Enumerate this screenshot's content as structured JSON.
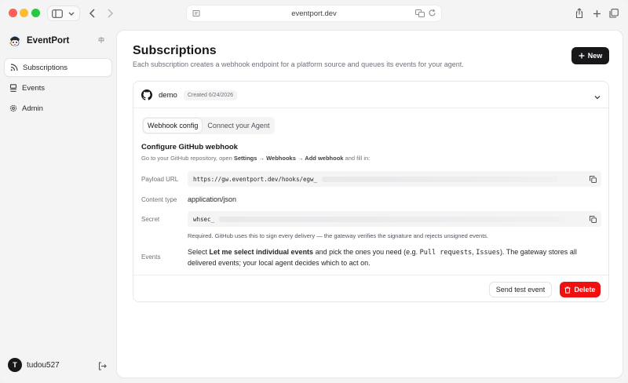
{
  "browser": {
    "url": "eventport.dev"
  },
  "sidebar": {
    "brand": "EventPort",
    "lang_label": "中",
    "items": [
      {
        "label": "Subscriptions",
        "icon": "rss-icon",
        "active": true
      },
      {
        "label": "Events",
        "icon": "inbox-stack-icon",
        "active": false
      },
      {
        "label": "Admin",
        "icon": "gear-icon",
        "active": false
      }
    ],
    "user": {
      "initial": "T",
      "name": "tudou527"
    }
  },
  "page": {
    "title": "Subscriptions",
    "description": "Each subscription creates a webhook endpoint for a platform source and queues its events for your agent.",
    "new_label": "New"
  },
  "subscription": {
    "name": "demo",
    "created": "Created 6/24/2026",
    "tabs": [
      "Webhook config",
      "Connect your Agent"
    ],
    "active_tab": 0,
    "section_title": "Configure GitHub webhook",
    "section_desc_prefix": "Go to your GitHub repository, open ",
    "section_desc_path1": "Settings",
    "section_desc_arrow1": " → ",
    "section_desc_path2": "Webhooks",
    "section_desc_arrow2": " → ",
    "section_desc_path3": "Add webhook",
    "section_desc_suffix": " and fill in:",
    "fields": {
      "payload_label": "Payload URL",
      "payload_value": "https://gw.eventport.dev/hooks/egw_",
      "content_type_label": "Content type",
      "content_type_value": "application/json",
      "secret_label": "Secret",
      "secret_value": "whsec_",
      "secret_help": "Required. GitHub uses this to sign every delivery — the gateway verifies the signature and rejects unsigned events.",
      "events_label": "Events",
      "events_text_1": "Select ",
      "events_text_bold": "Let me select individual events",
      "events_text_2": " and pick the ones you need (e.g. ",
      "events_code_1": "Pull requests",
      "events_text_3": ", ",
      "events_code_2": "Issues",
      "events_text_4": "). The gateway stores all delivered events; your local agent decides which to act on."
    },
    "send_test_label": "Send test event",
    "delete_label": "Delete"
  },
  "colors": {
    "accent_dark": "#18181b",
    "danger": "#ef1010",
    "traffic_red": "#fe5f57",
    "traffic_yellow": "#febc2e",
    "traffic_green": "#28c840"
  }
}
